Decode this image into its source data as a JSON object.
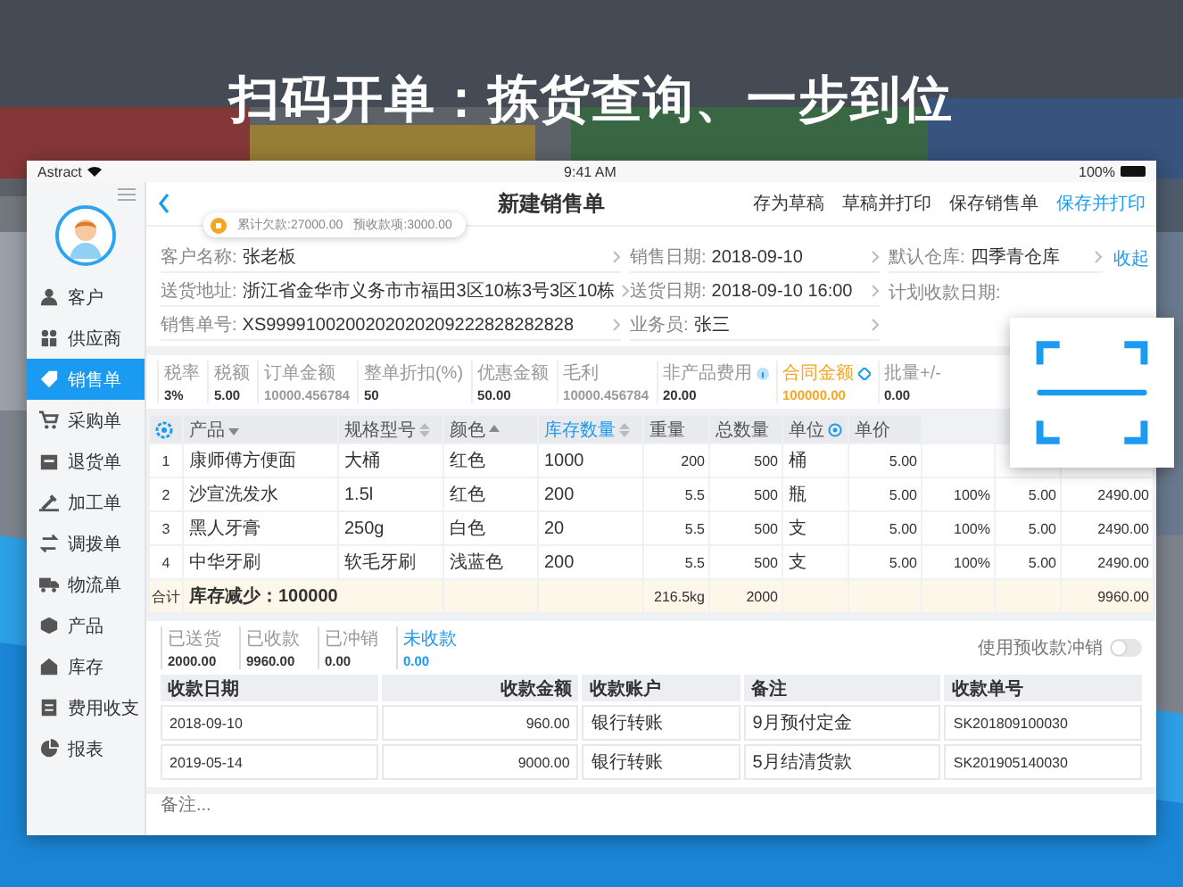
{
  "headline": "扫码开单：拣货查询、一步到位",
  "status_bar": {
    "carrier": "Astract",
    "time": "9:41 AM",
    "battery": "100%"
  },
  "sidebar": {
    "items": [
      {
        "label": "客户",
        "selected": false
      },
      {
        "label": "供应商",
        "selected": false
      },
      {
        "label": "销售单",
        "selected": true
      },
      {
        "label": "采购单",
        "selected": false
      },
      {
        "label": "退货单",
        "selected": false
      },
      {
        "label": "加工单",
        "selected": false
      },
      {
        "label": "调拨单",
        "selected": false
      },
      {
        "label": "物流单",
        "selected": false
      },
      {
        "label": "产品",
        "selected": false
      },
      {
        "label": "库存",
        "selected": false
      },
      {
        "label": "费用收支",
        "selected": false
      },
      {
        "label": "报表",
        "selected": false
      }
    ]
  },
  "nav": {
    "title": "新建销售单",
    "actions": [
      {
        "label": "存为草稿",
        "primary": false
      },
      {
        "label": "草稿并打印",
        "primary": false
      },
      {
        "label": "保存销售单",
        "primary": false
      },
      {
        "label": "保存并打印",
        "primary": true
      }
    ]
  },
  "toast": {
    "debt": "累计欠款:27000.00",
    "prepaid": "预收款项:3000.00"
  },
  "form": {
    "collapse": "收起",
    "rows": [
      [
        {
          "label": "客户名称:",
          "value": "张老板"
        },
        {
          "label": "销售日期:",
          "value": "2018-09-10"
        },
        {
          "label": "默认仓库:",
          "value": "四季青仓库"
        }
      ],
      [
        {
          "label": "送货地址:",
          "value": "浙江省金华市义务市市福田3区10栋3号3区10栋"
        },
        {
          "label": "送货日期:",
          "value": "2018-09-10 16:00"
        },
        {
          "label": "计划收款日期:"
        }
      ],
      [
        {
          "label": "销售单号:",
          "value": "XS9999100200202020209222828282828"
        },
        {
          "label": "业务员:",
          "value": "张三"
        }
      ]
    ]
  },
  "summary": {
    "items": [
      {
        "label": "税率",
        "value": "3%",
        "color": "#333333",
        "highlight": false,
        "kind": "plain"
      },
      {
        "label": "税额",
        "value": "5.00",
        "color": "#333333",
        "highlight": false,
        "kind": "plain"
      },
      {
        "label": "订单金额",
        "value": "10000.456784",
        "color": "#999999",
        "highlight": false,
        "kind": "plain"
      },
      {
        "label": "整单折扣(%)",
        "value": "50",
        "color": "#333333",
        "highlight": false,
        "kind": "plain"
      },
      {
        "label": "优惠金额",
        "value": "50.00",
        "color": "#333333",
        "highlight": false,
        "kind": "plain"
      },
      {
        "label": "毛利",
        "value": "10000.456784",
        "color": "#999999",
        "highlight": false,
        "kind": "plain"
      },
      {
        "label": "非产品费用",
        "value": "20.00",
        "color": "#333333",
        "highlight": false,
        "kind": "info"
      },
      {
        "label": "合同金额",
        "value": "100000.00",
        "color": "#f5a623",
        "highlight": true,
        "kind": "calc"
      },
      {
        "label": "批量+/-",
        "value": "0.00",
        "color": "#333333",
        "highlight": false,
        "kind": "plain"
      }
    ]
  },
  "table": {
    "columns": [
      {
        "kind": "settings"
      },
      {
        "label": "产品",
        "kind": "sort_desc",
        "active": false
      },
      {
        "label": "规格型号",
        "kind": "sort_both",
        "active": false
      },
      {
        "label": "颜色",
        "kind": "sort_asc",
        "active": false
      },
      {
        "label": "库存数量",
        "kind": "sort_both",
        "active": true
      },
      {
        "label": "重量",
        "kind": "plain",
        "active": false
      },
      {
        "label": "总数量",
        "kind": "plain",
        "active": false
      },
      {
        "label": "单位",
        "kind": "info",
        "active": false
      },
      {
        "label": "单价",
        "kind": "plain",
        "active": false
      }
    ],
    "rows": [
      {
        "cells": [
          "1",
          "康师傅方便面",
          "大桶",
          "红色",
          "1000",
          "200",
          "500",
          "桶",
          "5.00"
        ]
      },
      {
        "cells": [
          "2",
          "沙宣洗发水",
          "1.5l",
          "红色",
          "200",
          "5.5",
          "500",
          "瓶",
          "5.00",
          "100%",
          "5.00",
          "2490.00"
        ]
      },
      {
        "cells": [
          "3",
          "黑人牙膏",
          "250g",
          "白色",
          "20",
          "5.5",
          "500",
          "支",
          "5.00",
          "100%",
          "5.00",
          "2490.00"
        ]
      },
      {
        "cells": [
          "4",
          "中华牙刷",
          "软毛牙刷",
          "浅蓝色",
          "200",
          "5.5",
          "500",
          "支",
          "5.00",
          "100%",
          "5.00",
          "2490.00"
        ]
      }
    ],
    "totals": {
      "label": "合计",
      "stock": "库存减少：100000",
      "weight": "216.5kg",
      "quantity": "2000",
      "amount": "9960.00"
    }
  },
  "payment_summary": {
    "items": [
      {
        "label": "已送货",
        "value": "2000.00",
        "color": "#333333",
        "highlight": false
      },
      {
        "label": "已收款",
        "value": "9960.00",
        "color": "#333333",
        "highlight": false
      },
      {
        "label": "已冲销",
        "value": "0.00",
        "color": "#333333",
        "highlight": false
      },
      {
        "label": "未收款",
        "value": "0.00",
        "color": "#1a9af0",
        "highlight": true
      }
    ],
    "toggle": {
      "label": "使用预收款冲销",
      "on": false
    }
  },
  "payments": {
    "columns": [
      {
        "label": "收款日期",
        "kind": "text"
      },
      {
        "label": "收款金额",
        "kind": "number"
      },
      {
        "label": "收款账户",
        "kind": "text"
      },
      {
        "label": "备注",
        "kind": "text"
      },
      {
        "label": "收款单号",
        "kind": "text"
      }
    ],
    "rows": [
      {
        "cells": [
          "2018-09-10",
          "960.00",
          "银行转账",
          "9月预付定金",
          "SK201809100030"
        ]
      },
      {
        "cells": [
          "2019-05-14",
          "9000.00",
          "银行转账",
          "5月结清货款",
          "SK201905140030"
        ]
      }
    ]
  },
  "notes": {
    "placeholder": "备注..."
  }
}
